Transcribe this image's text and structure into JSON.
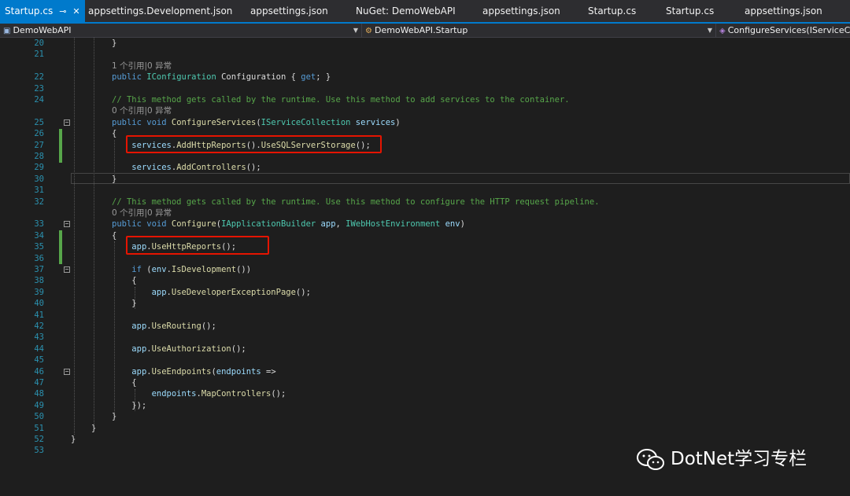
{
  "tabs": [
    {
      "label": "Startup.cs",
      "active": true
    },
    {
      "label": "appsettings.Development.json"
    },
    {
      "label": "appsettings.json"
    },
    {
      "label": "NuGet: DemoWebAPI"
    },
    {
      "label": "appsettings.json"
    },
    {
      "label": "Startup.cs"
    },
    {
      "label": "Startup.cs"
    },
    {
      "label": "appsettings.json"
    }
  ],
  "tab_pin_glyph": "⊸",
  "tab_close_glyph": "✕",
  "navbar": {
    "project": "DemoWebAPI",
    "class": "DemoWebAPI.Startup",
    "member": "ConfigureServices(IServiceC"
  },
  "lines": [
    {
      "n": "20",
      "tokens": [
        {
          "t": "}",
          "c": "pl"
        }
      ]
    },
    {
      "n": "21",
      "tokens": []
    },
    {
      "n": "",
      "lens": "1 个引用|0 异常"
    },
    {
      "n": "22",
      "tokens": [
        {
          "t": "public ",
          "c": "kw"
        },
        {
          "t": "IConfiguration",
          "c": "ty"
        },
        {
          "t": " Configuration { ",
          "c": "pl"
        },
        {
          "t": "get",
          "c": "kw"
        },
        {
          "t": "; }",
          "c": "pl"
        }
      ]
    },
    {
      "n": "23",
      "tokens": []
    },
    {
      "n": "24",
      "tokens": [
        {
          "t": "// This method gets called by the runtime. Use this method to add services to the container.",
          "c": "cm"
        }
      ]
    },
    {
      "n": "",
      "lens": "0 个引用|0 异常"
    },
    {
      "n": "25",
      "tokens": [
        {
          "t": "public ",
          "c": "kw"
        },
        {
          "t": "void ",
          "c": "kw"
        },
        {
          "t": "ConfigureServices",
          "c": "mt"
        },
        {
          "t": "(",
          "c": "pl"
        },
        {
          "t": "IServiceCollection",
          "c": "ty"
        },
        {
          "t": " ",
          "c": "pl"
        },
        {
          "t": "services",
          "c": "pm"
        },
        {
          "t": ")",
          "c": "pl"
        }
      ]
    },
    {
      "n": "26",
      "tokens": [
        {
          "t": "{",
          "c": "pl"
        }
      ]
    },
    {
      "n": "27",
      "tokens": [
        {
          "t": "    ",
          "c": "pl"
        },
        {
          "t": "services",
          "c": "pm"
        },
        {
          "t": ".",
          "c": "pl"
        },
        {
          "t": "AddHttpReports",
          "c": "mt"
        },
        {
          "t": "().",
          "c": "pl"
        },
        {
          "t": "UseSQLServerStorage",
          "c": "mt"
        },
        {
          "t": "();",
          "c": "pl"
        }
      ]
    },
    {
      "n": "28",
      "tokens": []
    },
    {
      "n": "29",
      "tokens": [
        {
          "t": "    ",
          "c": "pl"
        },
        {
          "t": "services",
          "c": "pm"
        },
        {
          "t": ".",
          "c": "pl"
        },
        {
          "t": "AddControllers",
          "c": "mt"
        },
        {
          "t": "();",
          "c": "pl"
        }
      ]
    },
    {
      "n": "30",
      "tokens": [
        {
          "t": "}",
          "c": "pl"
        }
      ]
    },
    {
      "n": "31",
      "tokens": []
    },
    {
      "n": "32",
      "tokens": [
        {
          "t": "// This method gets called by the runtime. Use this method to configure the HTTP request pipeline.",
          "c": "cm"
        }
      ]
    },
    {
      "n": "",
      "lens": "0 个引用|0 异常"
    },
    {
      "n": "33",
      "tokens": [
        {
          "t": "public ",
          "c": "kw"
        },
        {
          "t": "void ",
          "c": "kw"
        },
        {
          "t": "Configure",
          "c": "mt"
        },
        {
          "t": "(",
          "c": "pl"
        },
        {
          "t": "IApplicationBuilder",
          "c": "ty"
        },
        {
          "t": " ",
          "c": "pl"
        },
        {
          "t": "app",
          "c": "pm"
        },
        {
          "t": ", ",
          "c": "pl"
        },
        {
          "t": "IWebHostEnvironment",
          "c": "ty"
        },
        {
          "t": " ",
          "c": "pl"
        },
        {
          "t": "env",
          "c": "pm"
        },
        {
          "t": ")",
          "c": "pl"
        }
      ]
    },
    {
      "n": "34",
      "tokens": [
        {
          "t": "{",
          "c": "pl"
        }
      ]
    },
    {
      "n": "35",
      "tokens": [
        {
          "t": "    ",
          "c": "pl"
        },
        {
          "t": "app",
          "c": "pm"
        },
        {
          "t": ".",
          "c": "pl"
        },
        {
          "t": "UseHttpReports",
          "c": "mt"
        },
        {
          "t": "();",
          "c": "pl"
        }
      ]
    },
    {
      "n": "36",
      "tokens": []
    },
    {
      "n": "37",
      "tokens": [
        {
          "t": "    ",
          "c": "pl"
        },
        {
          "t": "if",
          "c": "kw"
        },
        {
          "t": " (",
          "c": "pl"
        },
        {
          "t": "env",
          "c": "pm"
        },
        {
          "t": ".",
          "c": "pl"
        },
        {
          "t": "IsDevelopment",
          "c": "mt"
        },
        {
          "t": "())",
          "c": "pl"
        }
      ]
    },
    {
      "n": "38",
      "tokens": [
        {
          "t": "    {",
          "c": "pl"
        }
      ]
    },
    {
      "n": "39",
      "tokens": [
        {
          "t": "        ",
          "c": "pl"
        },
        {
          "t": "app",
          "c": "pm"
        },
        {
          "t": ".",
          "c": "pl"
        },
        {
          "t": "UseDeveloperExceptionPage",
          "c": "mt"
        },
        {
          "t": "();",
          "c": "pl"
        }
      ]
    },
    {
      "n": "40",
      "tokens": [
        {
          "t": "    }",
          "c": "pl"
        }
      ]
    },
    {
      "n": "41",
      "tokens": []
    },
    {
      "n": "42",
      "tokens": [
        {
          "t": "    ",
          "c": "pl"
        },
        {
          "t": "app",
          "c": "pm"
        },
        {
          "t": ".",
          "c": "pl"
        },
        {
          "t": "UseRouting",
          "c": "mt"
        },
        {
          "t": "();",
          "c": "pl"
        }
      ]
    },
    {
      "n": "43",
      "tokens": []
    },
    {
      "n": "44",
      "tokens": [
        {
          "t": "    ",
          "c": "pl"
        },
        {
          "t": "app",
          "c": "pm"
        },
        {
          "t": ".",
          "c": "pl"
        },
        {
          "t": "UseAuthorization",
          "c": "mt"
        },
        {
          "t": "();",
          "c": "pl"
        }
      ]
    },
    {
      "n": "45",
      "tokens": []
    },
    {
      "n": "46",
      "tokens": [
        {
          "t": "    ",
          "c": "pl"
        },
        {
          "t": "app",
          "c": "pm"
        },
        {
          "t": ".",
          "c": "pl"
        },
        {
          "t": "UseEndpoints",
          "c": "mt"
        },
        {
          "t": "(",
          "c": "pl"
        },
        {
          "t": "endpoints",
          "c": "pm"
        },
        {
          "t": " =>",
          "c": "pl"
        }
      ]
    },
    {
      "n": "47",
      "tokens": [
        {
          "t": "    {",
          "c": "pl"
        }
      ]
    },
    {
      "n": "48",
      "tokens": [
        {
          "t": "        ",
          "c": "pl"
        },
        {
          "t": "endpoints",
          "c": "pm"
        },
        {
          "t": ".",
          "c": "pl"
        },
        {
          "t": "MapControllers",
          "c": "mt"
        },
        {
          "t": "();",
          "c": "pl"
        }
      ]
    },
    {
      "n": "49",
      "tokens": [
        {
          "t": "    });",
          "c": "pl"
        }
      ]
    },
    {
      "n": "50",
      "tokens": [
        {
          "t": "}",
          "c": "pl"
        }
      ]
    },
    {
      "n": "51",
      "tokens": [
        {
          "t": "}",
          "c": "pl"
        }
      ]
    },
    {
      "n": "52",
      "tokens": [
        {
          "t": "}",
          "c": "pl"
        }
      ]
    },
    {
      "n": "53",
      "tokens": []
    }
  ],
  "watermark": "DotNet学习专栏",
  "colors": {
    "accent": "#007acc",
    "highlight_box": "#e51400",
    "change_marker": "#57a64a"
  }
}
